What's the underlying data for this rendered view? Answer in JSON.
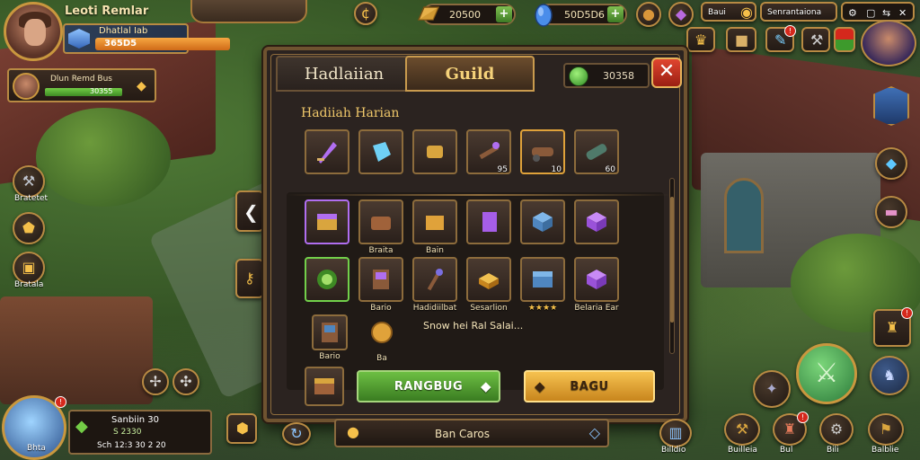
{
  "header": {
    "player_name": "Leoti Remlar",
    "player_subtitle": "Dhatlal Iab",
    "player_value": "365D5"
  },
  "resources": [
    {
      "name": "gold",
      "value": "20500",
      "color": "#e7b14a"
    },
    {
      "name": "gems",
      "value": "50D5D6",
      "color": "#4a8dea"
    }
  ],
  "top_right": {
    "label_a": "Baui",
    "label_b": "Senrantaiona"
  },
  "guild_notice": {
    "title": "Dlun Remd Bus",
    "value": "30355"
  },
  "left_menu": [
    {
      "label": "Bratetet",
      "icon": "anvil-icon"
    },
    {
      "label": "",
      "icon": "shield-icon"
    },
    {
      "label": "Bratala",
      "icon": "chest-icon"
    }
  ],
  "panel": {
    "tab_inactive": "Hadlaiian",
    "tab_active": "Guild",
    "counter_value": "30358",
    "close_label": "✕",
    "section_title": "Hadiiah Harian",
    "reward_row": [
      {
        "cap": ""
      },
      {
        "cap": ""
      },
      {
        "cap": ""
      },
      {
        "cap": "95"
      },
      {
        "cap": "10"
      },
      {
        "cap": "60"
      }
    ],
    "grid_row1": [
      {
        "label": ""
      },
      {
        "label": "Braita"
      },
      {
        "label": "Bain"
      },
      {
        "label": ""
      },
      {
        "label": ""
      },
      {
        "label": ""
      }
    ],
    "grid_row2": [
      {
        "label": ""
      },
      {
        "label": "Bario"
      },
      {
        "label": "Hadidiilbat"
      },
      {
        "label": "Sesarlion"
      },
      {
        "label": "★★★★"
      },
      {
        "label": "Belaria Ear"
      }
    ],
    "grid_row3": [
      {
        "label": "Bario"
      },
      {
        "label": "Ba"
      }
    ],
    "inline_text": "Snow hei Ral Salai...",
    "btn_green": "RANGBUG",
    "btn_gold": "BAGU"
  },
  "bottom": {
    "strip_text": "Ban Caros",
    "portrait_label": "Bhta",
    "info_line1": "Sanbiin 30",
    "info_line2": "S 2330",
    "info_line3": "Sch 12:3 30 2 20",
    "bottom_icons": [
      "Billdio",
      "Builleia",
      "Bul",
      "Bili",
      "Balblie"
    ]
  }
}
